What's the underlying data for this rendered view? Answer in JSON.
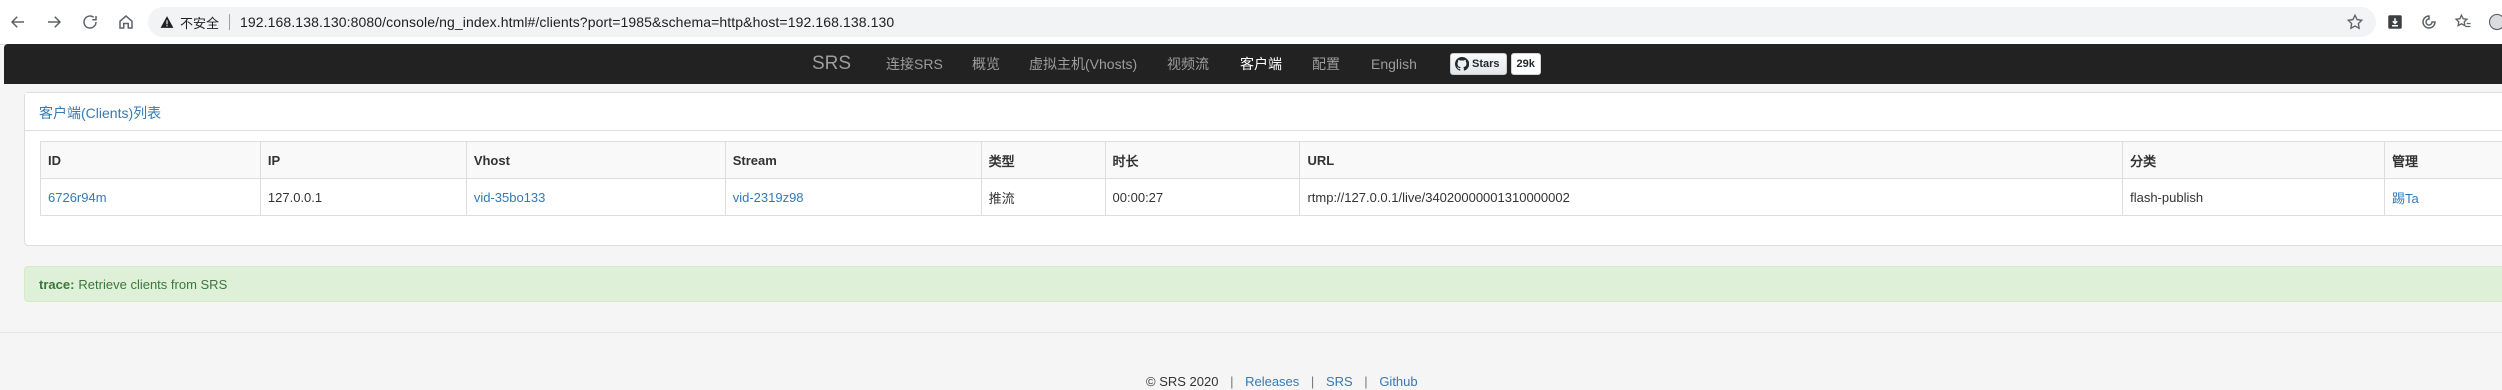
{
  "browser": {
    "insecure_label": "不安全",
    "url": "192.168.138.130:8080/console/ng_index.html#/clients?port=1985&schema=http&host=192.168.138.130"
  },
  "navbar": {
    "brand": "SRS",
    "items": [
      {
        "label": "连接SRS"
      },
      {
        "label": "概览"
      },
      {
        "label": "虚拟主机(Vhosts)"
      },
      {
        "label": "视频流"
      },
      {
        "label": "客户端"
      },
      {
        "label": "配置"
      },
      {
        "label": "English"
      }
    ],
    "active_index": 4,
    "github": {
      "stars_label": "Stars",
      "count": "29k"
    }
  },
  "clients_panel": {
    "title": "客户端(Clients)列表",
    "columns": [
      "ID",
      "IP",
      "Vhost",
      "Stream",
      "类型",
      "时长",
      "URL",
      "分类",
      "管理"
    ],
    "rows": [
      {
        "id": "6726r94m",
        "ip": "127.0.0.1",
        "vhost": "vid-35bo133",
        "stream": "vid-2319z98",
        "type": "推流",
        "duration": "00:00:27",
        "url": "rtmp://127.0.0.1/live/34020000001310000002",
        "category": "flash-publish",
        "action": "踢Ta"
      }
    ]
  },
  "trace": {
    "label": "trace:",
    "message": "Retrieve clients from SRS"
  },
  "footer": {
    "copyright": "© SRS 2020",
    "links": [
      "Releases",
      "SRS",
      "Github"
    ]
  },
  "colors": {
    "navbar_bg": "#222222",
    "link": "#337ab7",
    "alert_bg": "#dff0d8",
    "alert_text": "#3c763d"
  }
}
